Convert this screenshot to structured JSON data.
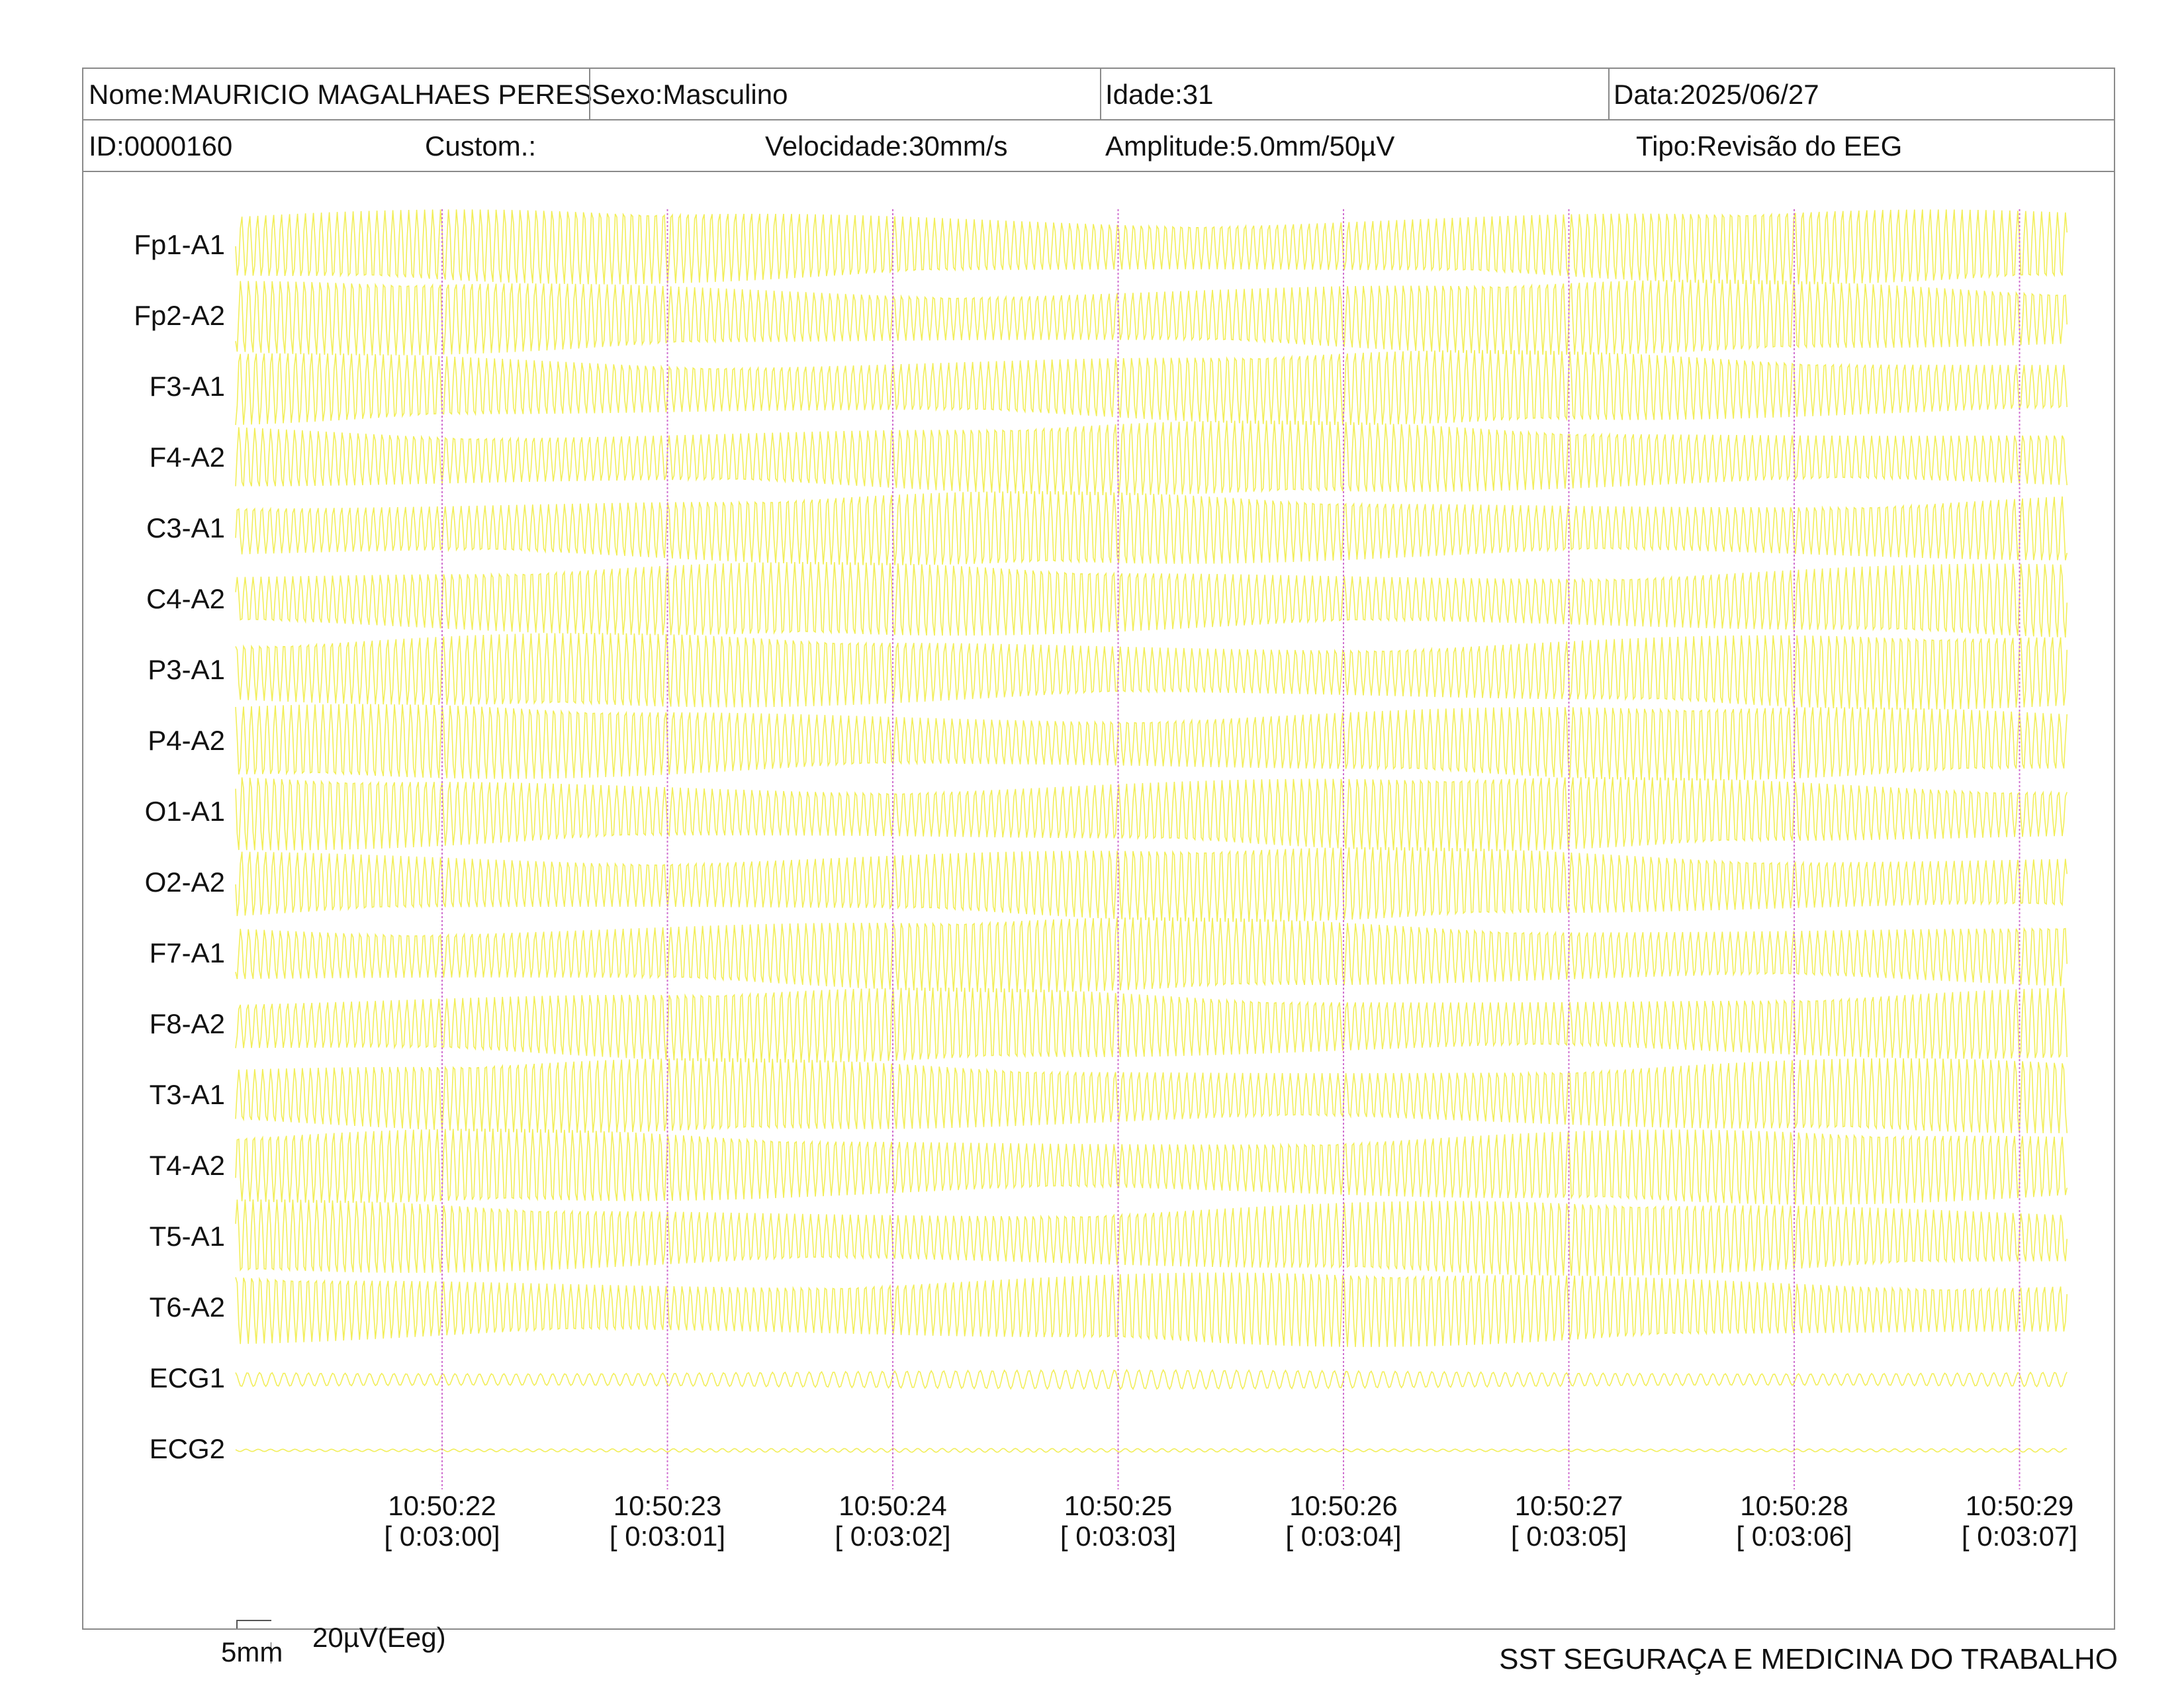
{
  "header": {
    "name": "Nome:MAURICIO MAGALHAES PERES",
    "sex": "Sexo:Masculino",
    "age": "Idade:31",
    "date": "Data:2025/06/27",
    "id": "ID:0000160",
    "custom": "Custom.:",
    "speed": "Velocidade:30mm/s",
    "amplitude": "Amplitude:5.0mm/50µV",
    "type": "Tipo:Revisão do EEG"
  },
  "channels": [
    {
      "label": "Fp1-A1",
      "kind": "eeg",
      "amp": 1.0
    },
    {
      "label": "Fp2-A2",
      "kind": "eeg",
      "amp": 1.0
    },
    {
      "label": "F3-A1",
      "kind": "eeg",
      "amp": 1.0
    },
    {
      "label": "F4-A2",
      "kind": "eeg",
      "amp": 1.0
    },
    {
      "label": "C3-A1",
      "kind": "eeg",
      "amp": 1.0
    },
    {
      "label": "C4-A2",
      "kind": "eeg",
      "amp": 1.0
    },
    {
      "label": "P3-A1",
      "kind": "eeg",
      "amp": 1.0
    },
    {
      "label": "P4-A2",
      "kind": "eeg",
      "amp": 1.0
    },
    {
      "label": "O1-A1",
      "kind": "eeg",
      "amp": 1.0
    },
    {
      "label": "O2-A2",
      "kind": "eeg",
      "amp": 1.0
    },
    {
      "label": "F7-A1",
      "kind": "eeg",
      "amp": 1.0
    },
    {
      "label": "F8-A2",
      "kind": "eeg",
      "amp": 1.0
    },
    {
      "label": "T3-A1",
      "kind": "eeg",
      "amp": 1.0
    },
    {
      "label": "T4-A2",
      "kind": "eeg",
      "amp": 1.0
    },
    {
      "label": "T5-A1",
      "kind": "eeg",
      "amp": 1.0
    },
    {
      "label": "T6-A2",
      "kind": "eeg",
      "amp": 1.0
    },
    {
      "label": "ECG1",
      "kind": "ecg",
      "amp": 0.25
    },
    {
      "label": "ECG2",
      "kind": "ecg",
      "amp": 0.05
    }
  ],
  "time_markers": [
    {
      "clock": "10:50:22",
      "elapsed": "[ 0:03:00]"
    },
    {
      "clock": "10:50:23",
      "elapsed": "[ 0:03:01]"
    },
    {
      "clock": "10:50:24",
      "elapsed": "[ 0:03:02]"
    },
    {
      "clock": "10:50:25",
      "elapsed": "[ 0:03:03]"
    },
    {
      "clock": "10:50:26",
      "elapsed": "[ 0:03:04]"
    },
    {
      "clock": "10:50:27",
      "elapsed": "[ 0:03:05]"
    },
    {
      "clock": "10:50:28",
      "elapsed": "[ 0:03:06]"
    },
    {
      "clock": "10:50:29",
      "elapsed": "[ 0:03:07]"
    }
  ],
  "scale": {
    "horizontal": "5mm",
    "vertical": "20µV(Eeg)"
  },
  "footer": {
    "organization": "SST SEGURAÇA E MEDICINA DO TRABALHO"
  },
  "colors": {
    "trace": "#f2ee5a",
    "marker": "#d070d0",
    "border": "#8a8a8a",
    "text": "#111111"
  }
}
